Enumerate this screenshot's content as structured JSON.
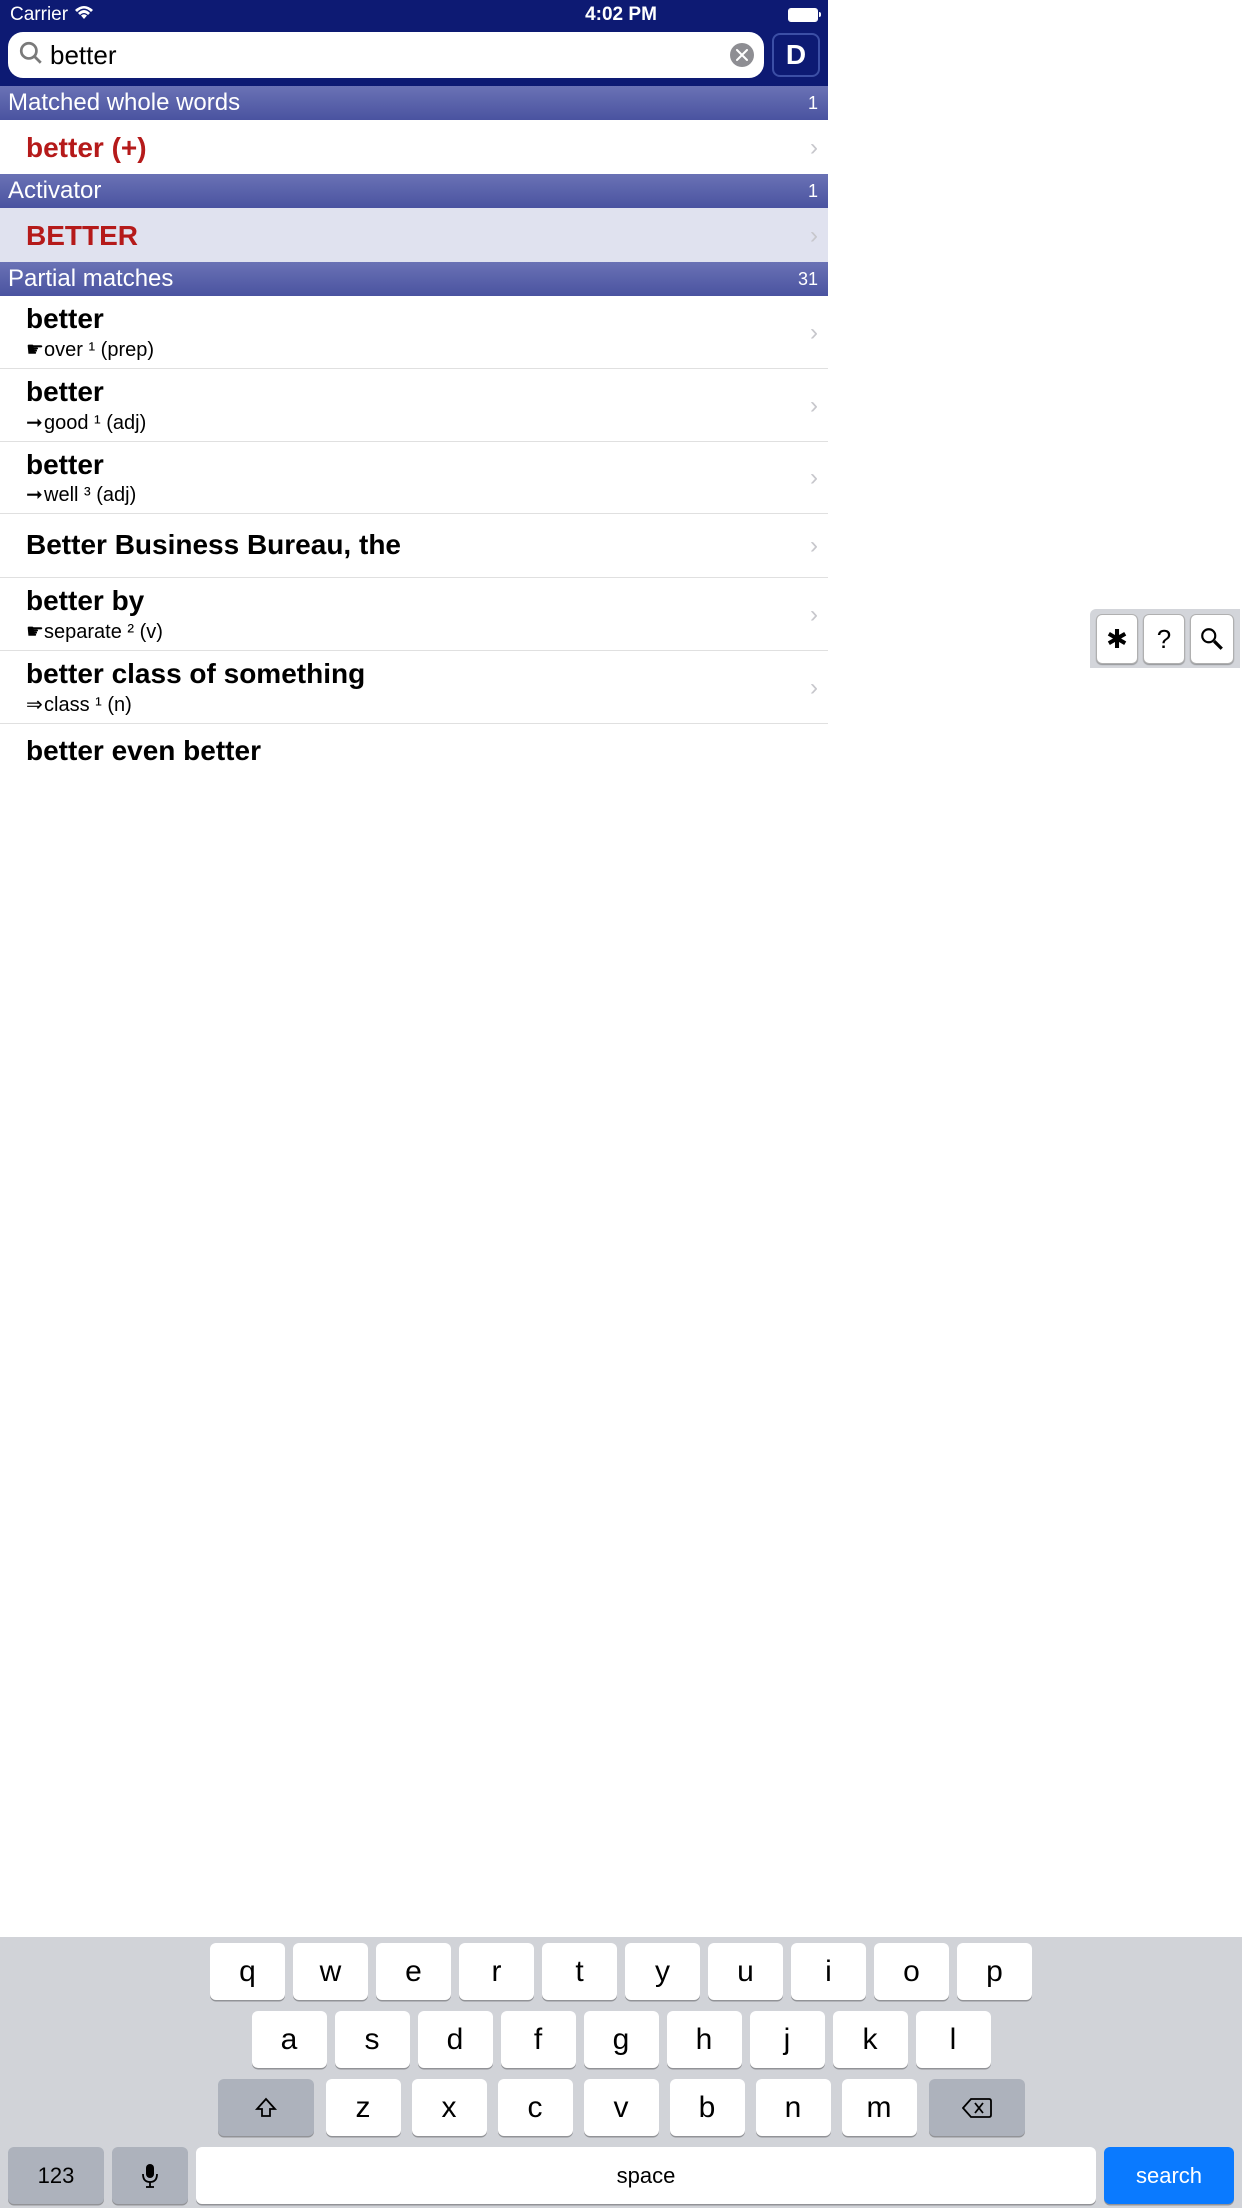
{
  "status": {
    "carrier": "Carrier",
    "time": "4:02 PM"
  },
  "search": {
    "value": "better",
    "d_label": "D"
  },
  "sections": {
    "matched": {
      "title": "Matched whole words",
      "count": "1"
    },
    "activator": {
      "title": "Activator",
      "count": "1"
    },
    "partial": {
      "title": "Partial matches",
      "count": "31"
    }
  },
  "rows": {
    "matched1": {
      "title": "better (+)"
    },
    "activator1": {
      "title": "BETTER"
    },
    "p1": {
      "title": "better",
      "bullet": "☛",
      "sub": "over ¹ (prep)"
    },
    "p2": {
      "title": "better",
      "bullet": "➞",
      "sub": "good ¹ (adj)"
    },
    "p3": {
      "title": "better",
      "bullet": "➞",
      "sub": "well ³ (adj)"
    },
    "p4": {
      "title": "Better Business Bureau, the"
    },
    "p5": {
      "title": "better by",
      "bullet": "☛",
      "sub": "separate ² (v)"
    },
    "p6": {
      "title": "better class of something",
      "bullet": "⇒",
      "sub": "class ¹ (n)"
    },
    "p7": {
      "title": "better even better"
    }
  },
  "toolbar": {
    "star": "✱",
    "q": "?",
    "mag": "🔍"
  },
  "keyboard": {
    "r1": [
      "q",
      "w",
      "e",
      "r",
      "t",
      "y",
      "u",
      "i",
      "o",
      "p"
    ],
    "r2": [
      "a",
      "s",
      "d",
      "f",
      "g",
      "h",
      "j",
      "k",
      "l"
    ],
    "r3": [
      "z",
      "x",
      "c",
      "v",
      "b",
      "n",
      "m"
    ],
    "num": "123",
    "space": "space",
    "search": "search"
  }
}
